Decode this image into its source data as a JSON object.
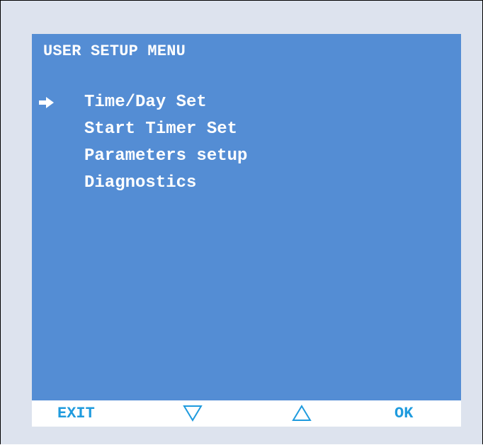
{
  "screen": {
    "title": "USER SETUP MENU",
    "selected_index": 0,
    "menu": [
      {
        "label": "Time/Day Set"
      },
      {
        "label": "Start Timer Set"
      },
      {
        "label": "Parameters setup"
      },
      {
        "label": "Diagnostics"
      }
    ]
  },
  "softkeys": {
    "exit_label": "EXIT",
    "down_icon": "triangle-down-outline",
    "up_icon": "triangle-up-outline",
    "ok_label": "OK"
  },
  "colors": {
    "screen_background": "#548dd4",
    "panel_background": "#dde3ee",
    "menu_text": "#ffffff",
    "softkey_text": "#1f9bde"
  }
}
